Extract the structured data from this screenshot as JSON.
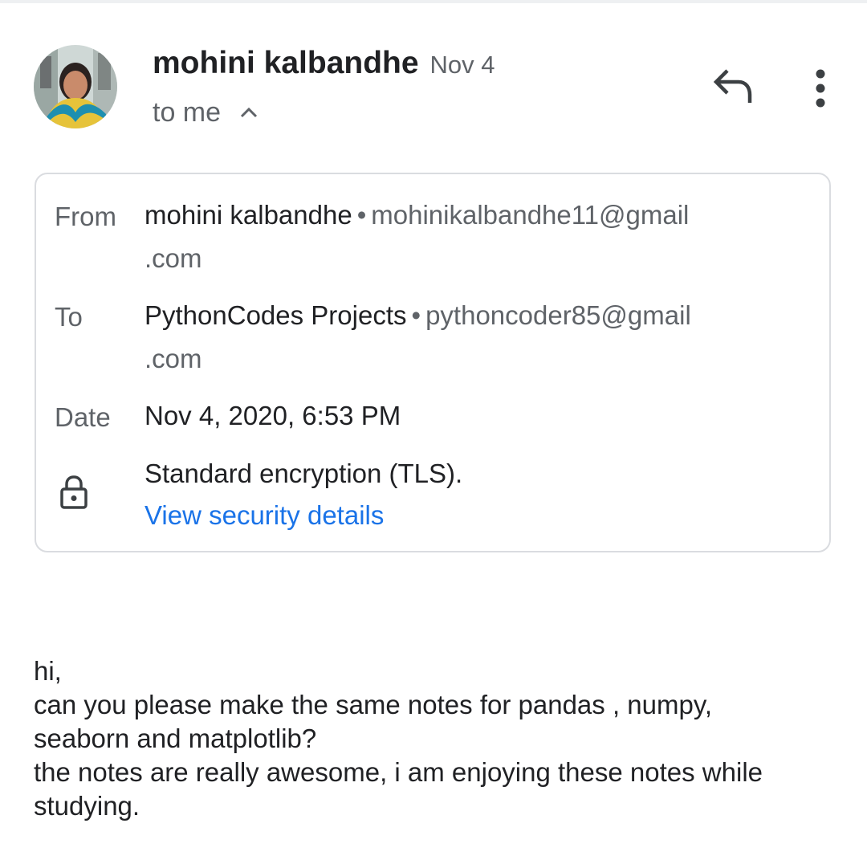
{
  "header": {
    "sender_name": "mohini kalbandhe",
    "date_short": "Nov 4",
    "recipient_summary": "to me",
    "icons": {
      "expand": "chevron-up-icon",
      "reply": "reply-icon",
      "more": "more-vert-icon",
      "avatar": "sender-avatar"
    }
  },
  "details": {
    "from_label": "From",
    "from_name": "mohini kalbandhe",
    "from_email_line1": "mohinikalbandhe11@gmail",
    "from_email_line2": ".com",
    "to_label": "To",
    "to_name": "PythonCodes Projects",
    "to_email_line1": "pythoncoder85@gmail",
    "to_email_line2": ".com",
    "date_label": "Date",
    "date_value": "Nov 4, 2020, 6:53 PM",
    "encryption": "Standard encryption (TLS).",
    "security_link": "View security details",
    "separator": "•"
  },
  "body": {
    "lines": [
      "hi,",
      "can you please make the same notes for pandas , numpy,",
      "seaborn and matplotlib?",
      "the notes are really awesome, i am enjoying these notes while",
      "studying."
    ]
  },
  "colors": {
    "text_primary": "#202124",
    "text_secondary": "#5f6368",
    "link": "#1a73e8",
    "border": "#dadce0"
  }
}
